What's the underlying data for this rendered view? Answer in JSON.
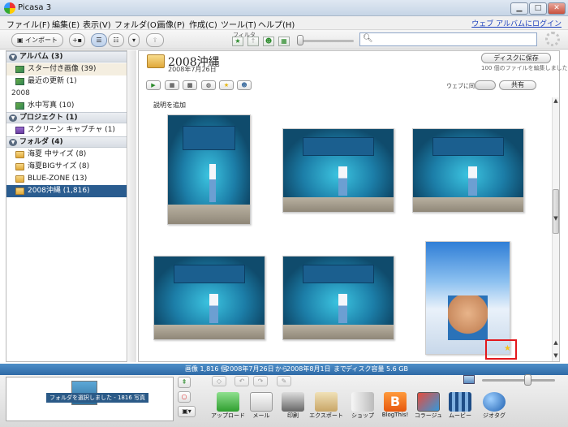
{
  "window": {
    "title": "Picasa 3"
  },
  "menu": {
    "items": [
      "ファイル(F)",
      "編集(E)",
      "表示(V)",
      "フォルダ(O)",
      "画像(P)",
      "作成(C)",
      "ツール(T)",
      "ヘルプ(H)"
    ],
    "web_login": "ウェブ アルバムにログイン"
  },
  "toolbar": {
    "import_label": "インポート",
    "filter_label": "フィルタ",
    "search_placeholder": ""
  },
  "sidebar": {
    "albums_header": "アルバム (3)",
    "albums": [
      {
        "label": "スター付き画像 (39)"
      },
      {
        "label": "最近の更新 (1)"
      }
    ],
    "year_2008": "2008",
    "year_items": [
      {
        "label": "水中写真 (10)"
      }
    ],
    "projects_header": "プロジェクト (1)",
    "projects": [
      {
        "label": "スクリーン キャプチャ (1)"
      }
    ],
    "folders_header": "フォルダ (4)",
    "folders": [
      {
        "label": "海夏 中サイズ (8)"
      },
      {
        "label": "海夏BIGサイズ (8)"
      },
      {
        "label": "BLUE-ZONE (13)"
      },
      {
        "label": "2008沖縄 (1,816)"
      }
    ]
  },
  "main": {
    "folder_title": "2008沖縄",
    "folder_date": "2008年7月26日",
    "save_to_disk": "ディスクに保存",
    "edit_count": "100 個のファイルを編集しました",
    "web_sync": "ウェブに同期",
    "share": "共有",
    "caption_placeholder": "説明を追加"
  },
  "status": {
    "count": "画像 1,816 個",
    "start": "2008年7月26日",
    "from": "から",
    "end": "2008年8月1日",
    "until": "まで",
    "disk": "ディスク容量 5.6 GB"
  },
  "tray": {
    "label": "フォルダを選択しました - 1816 写真"
  },
  "bottom": {
    "upload": "アップロード",
    "mail": "メール",
    "print": "印刷",
    "export": "エクスポート",
    "shop": "ショップ",
    "blog": "BlogThis!",
    "collage": "コラージュ",
    "movie": "ムービー",
    "geotag": "ジオタグ"
  },
  "colors": {
    "selected": "#2a5c8f",
    "status": "#3b78b5",
    "highlight": "#e3181c"
  }
}
